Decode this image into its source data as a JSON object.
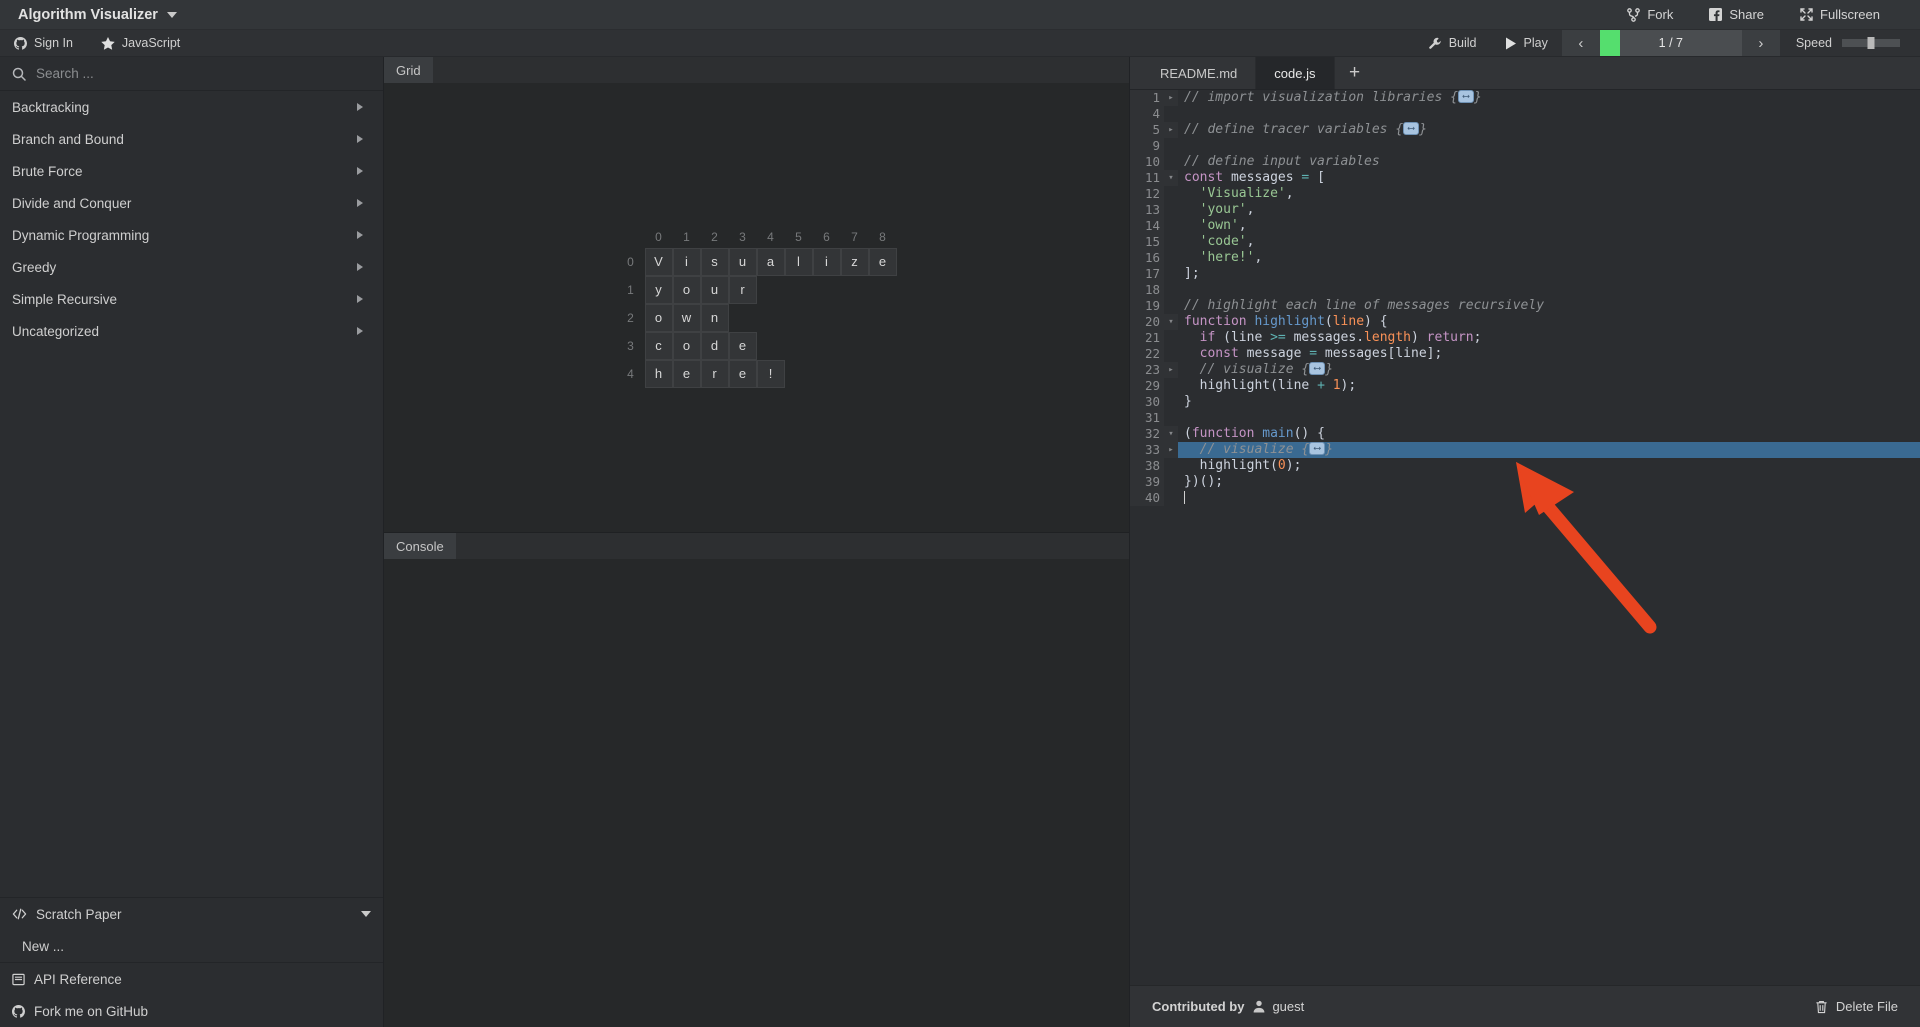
{
  "header": {
    "title": "Algorithm Visualizer",
    "dropdown_icon": "chevron-down-icon",
    "actions": [
      {
        "label": "Fork",
        "icon": "fork-icon"
      },
      {
        "label": "Share",
        "icon": "facebook-share-icon"
      },
      {
        "label": "Fullscreen",
        "icon": "fullscreen-icon"
      }
    ]
  },
  "subbar": {
    "sign_in": {
      "label": "Sign In",
      "icon": "github-icon"
    },
    "language": {
      "label": "JavaScript",
      "icon": "star-icon"
    },
    "build": {
      "label": "Build",
      "icon": "wrench-icon"
    },
    "play": {
      "label": "Play",
      "icon": "play-icon"
    },
    "prev_icon": "chevron-left-icon",
    "next_icon": "chevron-right-icon",
    "progress": {
      "label": "1 / 7",
      "current": 1,
      "total": 7,
      "fill_color": "#55de6e",
      "track_color": "#4a4d50"
    },
    "speed": {
      "label": "Speed",
      "value": 50
    }
  },
  "sidebar": {
    "search": {
      "placeholder": "Search ...",
      "value": "",
      "icon": "search-icon"
    },
    "categories": [
      {
        "label": "Backtracking"
      },
      {
        "label": "Branch and Bound"
      },
      {
        "label": "Brute Force"
      },
      {
        "label": "Divide and Conquer"
      },
      {
        "label": "Dynamic Programming"
      },
      {
        "label": "Greedy"
      },
      {
        "label": "Simple Recursive"
      },
      {
        "label": "Uncategorized"
      }
    ],
    "scratch_paper": {
      "label": "Scratch Paper",
      "icon": "code-tags-icon",
      "expanded": true
    },
    "scratch_new": {
      "label": "New ..."
    },
    "api_reference": {
      "label": "API Reference",
      "icon": "book-icon"
    },
    "fork_github": {
      "label": "Fork me on GitHub",
      "icon": "github-icon"
    }
  },
  "viz": {
    "grid_panel": {
      "tab_label": "Grid"
    },
    "console_panel": {
      "tab_label": "Console",
      "output": ""
    },
    "grid_data": {
      "col_headers": [
        "0",
        "1",
        "2",
        "3",
        "4",
        "5",
        "6",
        "7",
        "8"
      ],
      "row_headers": [
        "0",
        "1",
        "2",
        "3",
        "4"
      ],
      "rows": [
        [
          "V",
          "i",
          "s",
          "u",
          "a",
          "l",
          "i",
          "z",
          "e"
        ],
        [
          "y",
          "o",
          "u",
          "r"
        ],
        [
          "o",
          "w",
          "n"
        ],
        [
          "c",
          "o",
          "d",
          "e"
        ],
        [
          "h",
          "e",
          "r",
          "e",
          "!"
        ]
      ]
    }
  },
  "editor": {
    "tabs": [
      {
        "label": "README.md",
        "active": false
      },
      {
        "label": "code.js",
        "active": true
      }
    ],
    "add_tab_label": "+",
    "lines": [
      {
        "num": "1",
        "fold": "▸",
        "hl": false,
        "tokens": [
          {
            "t": "cm",
            "v": "// import visualization libraries {"
          },
          {
            "t": "fold",
            "v": "⟷"
          },
          {
            "t": "cm",
            "v": "}"
          }
        ]
      },
      {
        "num": "4",
        "fold": "",
        "hl": false,
        "tokens": []
      },
      {
        "num": "5",
        "fold": "▸",
        "hl": false,
        "tokens": [
          {
            "t": "cm",
            "v": "// define tracer variables {"
          },
          {
            "t": "fold",
            "v": "⟷"
          },
          {
            "t": "cm",
            "v": "}"
          }
        ]
      },
      {
        "num": "9",
        "fold": "",
        "hl": false,
        "tokens": []
      },
      {
        "num": "10",
        "fold": "",
        "hl": false,
        "tokens": [
          {
            "t": "cm",
            "v": "// define input variables"
          }
        ]
      },
      {
        "num": "11",
        "fold": "▾",
        "hl": false,
        "tokens": [
          {
            "t": "kw",
            "v": "const"
          },
          {
            "t": "pl",
            "v": " messages "
          },
          {
            "t": "op",
            "v": "="
          },
          {
            "t": "pl",
            "v": " ["
          }
        ]
      },
      {
        "num": "12",
        "fold": "",
        "hl": false,
        "tokens": [
          {
            "t": "pl",
            "v": "  "
          },
          {
            "t": "str",
            "v": "'Visualize'"
          },
          {
            "t": "pl",
            "v": ","
          }
        ]
      },
      {
        "num": "13",
        "fold": "",
        "hl": false,
        "tokens": [
          {
            "t": "pl",
            "v": "  "
          },
          {
            "t": "str",
            "v": "'your'"
          },
          {
            "t": "pl",
            "v": ","
          }
        ]
      },
      {
        "num": "14",
        "fold": "",
        "hl": false,
        "tokens": [
          {
            "t": "pl",
            "v": "  "
          },
          {
            "t": "str",
            "v": "'own'"
          },
          {
            "t": "pl",
            "v": ","
          }
        ]
      },
      {
        "num": "15",
        "fold": "",
        "hl": false,
        "tokens": [
          {
            "t": "pl",
            "v": "  "
          },
          {
            "t": "str",
            "v": "'code'"
          },
          {
            "t": "pl",
            "v": ","
          }
        ]
      },
      {
        "num": "16",
        "fold": "",
        "hl": false,
        "tokens": [
          {
            "t": "pl",
            "v": "  "
          },
          {
            "t": "str",
            "v": "'here!'"
          },
          {
            "t": "pl",
            "v": ","
          }
        ]
      },
      {
        "num": "17",
        "fold": "",
        "hl": false,
        "tokens": [
          {
            "t": "pl",
            "v": "];"
          }
        ]
      },
      {
        "num": "18",
        "fold": "",
        "hl": false,
        "tokens": []
      },
      {
        "num": "19",
        "fold": "",
        "hl": false,
        "tokens": [
          {
            "t": "cm",
            "v": "// highlight each line of messages recursively"
          }
        ]
      },
      {
        "num": "20",
        "fold": "▾",
        "hl": false,
        "tokens": [
          {
            "t": "kw",
            "v": "function"
          },
          {
            "t": "pl",
            "v": " "
          },
          {
            "t": "fn",
            "v": "highlight"
          },
          {
            "t": "pl",
            "v": "("
          },
          {
            "t": "par",
            "v": "line"
          },
          {
            "t": "pl",
            "v": ") {"
          }
        ]
      },
      {
        "num": "21",
        "fold": "",
        "hl": false,
        "tokens": [
          {
            "t": "pl",
            "v": "  "
          },
          {
            "t": "kw",
            "v": "if"
          },
          {
            "t": "pl",
            "v": " (line "
          },
          {
            "t": "op",
            "v": ">="
          },
          {
            "t": "pl",
            "v": " messages."
          },
          {
            "t": "prop",
            "v": "length"
          },
          {
            "t": "pl",
            "v": ") "
          },
          {
            "t": "kw",
            "v": "return"
          },
          {
            "t": "pl",
            "v": ";"
          }
        ]
      },
      {
        "num": "22",
        "fold": "",
        "hl": false,
        "tokens": [
          {
            "t": "pl",
            "v": "  "
          },
          {
            "t": "kw",
            "v": "const"
          },
          {
            "t": "pl",
            "v": " message "
          },
          {
            "t": "op",
            "v": "="
          },
          {
            "t": "pl",
            "v": " messages[line];"
          }
        ]
      },
      {
        "num": "23",
        "fold": "▸",
        "hl": false,
        "tokens": [
          {
            "t": "cm",
            "v": "  // visualize {"
          },
          {
            "t": "fold",
            "v": "⟷"
          },
          {
            "t": "cm",
            "v": "}"
          }
        ]
      },
      {
        "num": "29",
        "fold": "",
        "hl": false,
        "tokens": [
          {
            "t": "pl",
            "v": "  highlight(line "
          },
          {
            "t": "op",
            "v": "+"
          },
          {
            "t": "pl",
            "v": " "
          },
          {
            "t": "num",
            "v": "1"
          },
          {
            "t": "pl",
            "v": ");"
          }
        ]
      },
      {
        "num": "30",
        "fold": "",
        "hl": false,
        "tokens": [
          {
            "t": "pl",
            "v": "}"
          }
        ]
      },
      {
        "num": "31",
        "fold": "",
        "hl": false,
        "tokens": []
      },
      {
        "num": "32",
        "fold": "▾",
        "hl": false,
        "tokens": [
          {
            "t": "pl",
            "v": "("
          },
          {
            "t": "kw",
            "v": "function"
          },
          {
            "t": "pl",
            "v": " "
          },
          {
            "t": "fn",
            "v": "main"
          },
          {
            "t": "pl",
            "v": "() {"
          }
        ]
      },
      {
        "num": "33",
        "fold": "▸",
        "hl": true,
        "tokens": [
          {
            "t": "cm",
            "v": "  // visualize {"
          },
          {
            "t": "fold",
            "v": "⟷"
          },
          {
            "t": "cm",
            "v": "}"
          }
        ]
      },
      {
        "num": "38",
        "fold": "",
        "hl": false,
        "tokens": [
          {
            "t": "pl",
            "v": "  highlight("
          },
          {
            "t": "num",
            "v": "0"
          },
          {
            "t": "pl",
            "v": ");"
          }
        ]
      },
      {
        "num": "39",
        "fold": "",
        "hl": false,
        "tokens": [
          {
            "t": "pl",
            "v": "})();"
          }
        ]
      },
      {
        "num": "40",
        "fold": "",
        "hl": false,
        "tokens": [
          {
            "t": "cursor",
            "v": ""
          }
        ]
      }
    ]
  },
  "statusbar": {
    "contributed_label": "Contributed by",
    "contributor": "guest",
    "contributor_icon": "person-icon",
    "delete_label": "Delete File",
    "delete_icon": "trash-icon"
  },
  "annotation": {
    "arrow_color": "#e8441f",
    "arrow_target": "code-line-33"
  }
}
